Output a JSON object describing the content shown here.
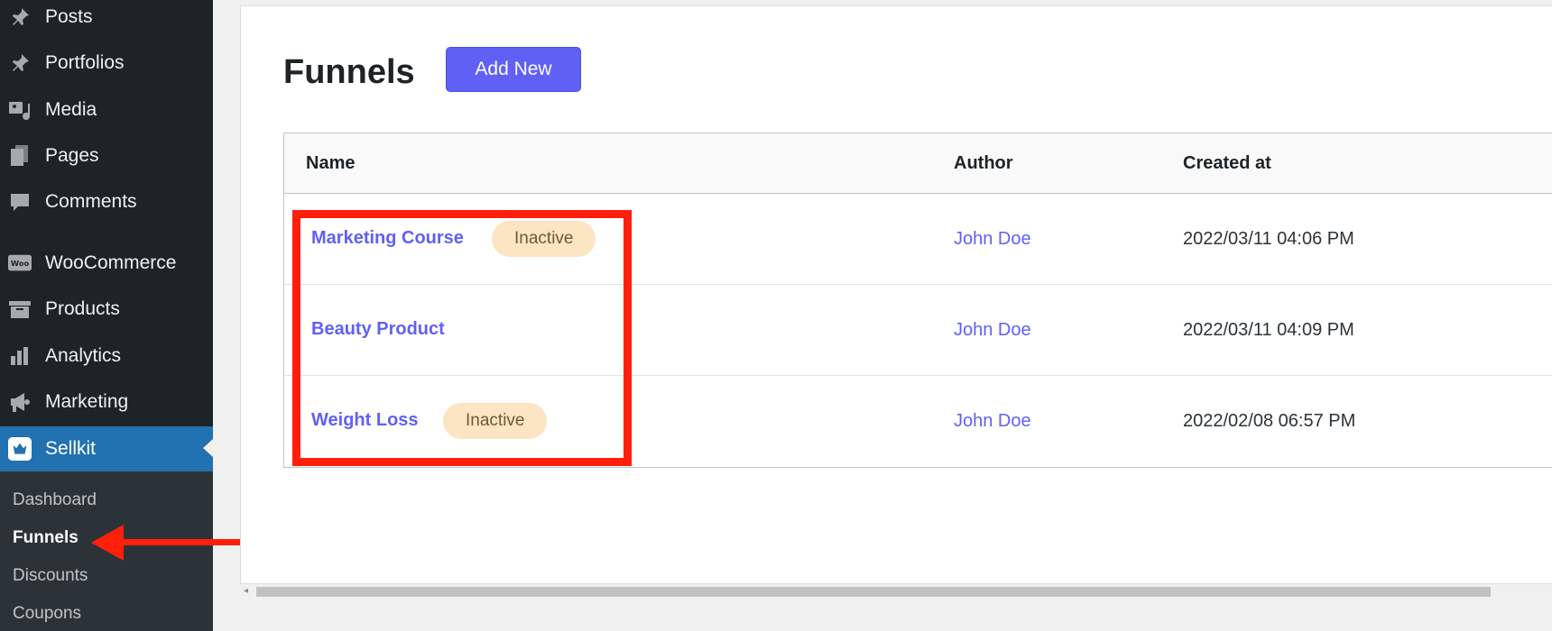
{
  "sidebar": {
    "items": [
      {
        "label": "Posts",
        "icon": "pin-icon"
      },
      {
        "label": "Portfolios",
        "icon": "pin-icon"
      },
      {
        "label": "Media",
        "icon": "media-icon"
      },
      {
        "label": "Pages",
        "icon": "pages-icon"
      },
      {
        "label": "Comments",
        "icon": "comment-icon"
      },
      {
        "label": "WooCommerce",
        "icon": "woo-icon"
      },
      {
        "label": "Products",
        "icon": "archive-icon"
      },
      {
        "label": "Analytics",
        "icon": "bar-chart-icon"
      },
      {
        "label": "Marketing",
        "icon": "megaphone-icon"
      },
      {
        "label": "Sellkit",
        "icon": "sellkit-icon"
      }
    ],
    "submenu": [
      "Dashboard",
      "Funnels",
      "Discounts",
      "Coupons"
    ]
  },
  "main": {
    "title": "Funnels",
    "add_new_label": "Add New",
    "table": {
      "headers": [
        "Name",
        "Author",
        "Created at"
      ],
      "rows": [
        {
          "name": "Marketing Course",
          "status": "Inactive",
          "author": "John Doe",
          "created_at": "2022/03/11 04:06 PM"
        },
        {
          "name": "Beauty Product",
          "status": "",
          "author": "John Doe",
          "created_at": "2022/03/11 04:09 PM"
        },
        {
          "name": "Weight Loss",
          "status": "Inactive",
          "author": "John Doe",
          "created_at": "2022/02/08 06:57 PM"
        }
      ]
    }
  },
  "colors": {
    "sidebar_bg": "#1d2327",
    "sidebar_active": "#2271b1",
    "accent": "#6160f5",
    "badge_bg": "#fbe5c2",
    "highlight": "#ff1f0a"
  }
}
